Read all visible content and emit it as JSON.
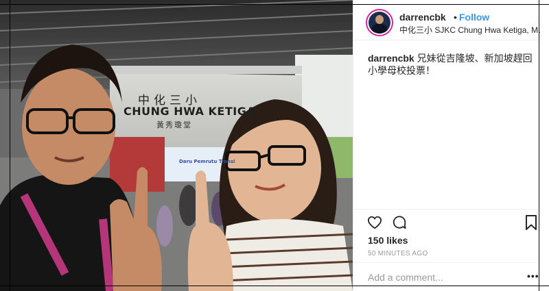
{
  "photo": {
    "sign_title": "中化三小",
    "sign_name": "CHUNG HWA KETIGA",
    "sign_hall": "黃秀瓊堂",
    "banner_text": "Daru Pemrutu Transi"
  },
  "post": {
    "username": "darrencbk",
    "separator": "•",
    "follow_label": "Follow",
    "location": "中化三小 SJKC Chung Hwa Ketiga, Muar",
    "caption_user": "darrencbk",
    "caption_text": " 兄妹從吉隆坡、新加坡趕回小學母校投票！",
    "likes": "150 likes",
    "time": "50 MINUTES AGO",
    "comment_placeholder": "Add a comment...",
    "more_label": "•••"
  },
  "icons": {
    "heart": "heart-icon",
    "comment": "comment-icon",
    "bookmark": "bookmark-icon"
  },
  "colors": {
    "follow": "#3897f0",
    "avatar_ring": "#d6249f",
    "lanyard": "#b5357a"
  }
}
